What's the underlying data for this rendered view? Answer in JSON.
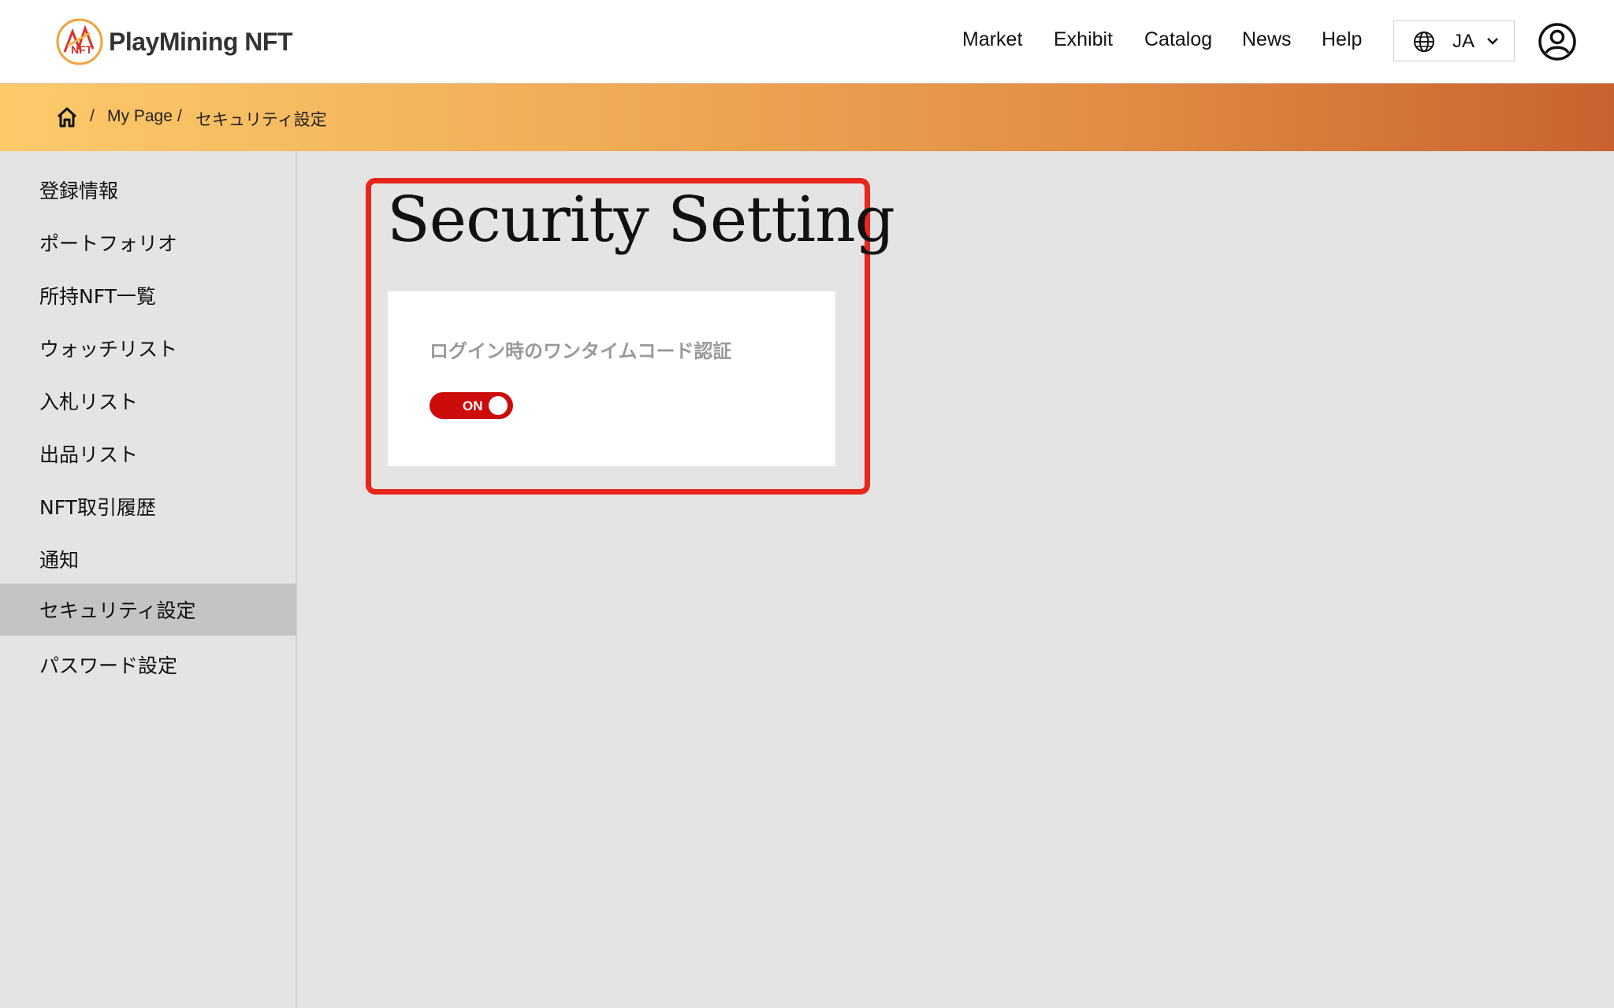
{
  "header": {
    "logo_text": "PlayMining NFT",
    "nav": [
      "Market",
      "Exhibit",
      "Catalog",
      "News",
      "Help"
    ],
    "language": "JA",
    "icons": [
      "globe-icon",
      "chevron-down-icon",
      "user-account-icon"
    ]
  },
  "breadcrumb": {
    "separator": "/",
    "items": [
      "My Page",
      "セキュリティ設定"
    ]
  },
  "sidebar": {
    "items": [
      {
        "label": "登録情報"
      },
      {
        "label": "ポートフォリオ"
      },
      {
        "label": "所持NFT一覧"
      },
      {
        "label": "ウォッチリスト"
      },
      {
        "label": "入札リスト"
      },
      {
        "label": "出品リスト"
      },
      {
        "label": "NFT取引履歴"
      },
      {
        "label": "通知"
      },
      {
        "label": "セキュリティ設定",
        "active": true
      },
      {
        "label": "パスワード設定"
      }
    ]
  },
  "main": {
    "title": "Security Setting",
    "setting_label": "ログイン時のワンタイムコード認証",
    "toggle_state": "ON"
  },
  "colors": {
    "toggle_on": "#cc0b0b",
    "highlight_border": "#e8261c",
    "breadcrumb_gradient_start": "#fdca6a",
    "breadcrumb_gradient_end": "#c9622f"
  }
}
